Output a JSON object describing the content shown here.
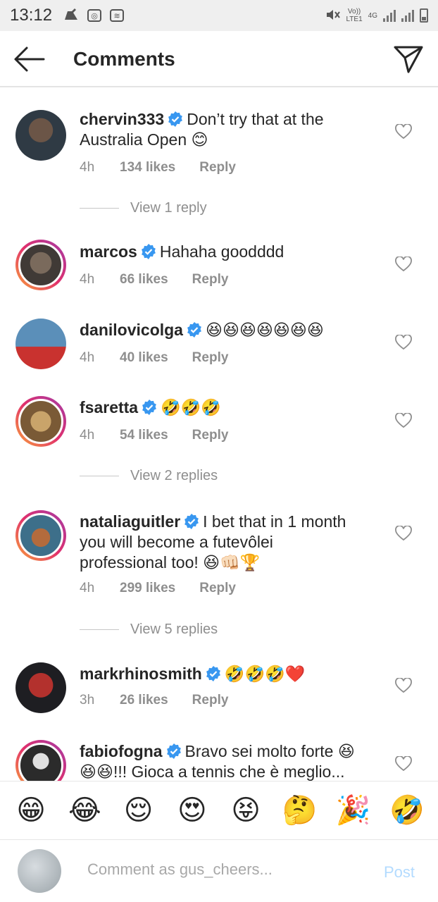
{
  "status": {
    "time": "13:12",
    "net_top": "Vo))",
    "net_bottom": "LTE1",
    "gen": "4G"
  },
  "header": {
    "title": "Comments"
  },
  "comments": [
    {
      "username": "chervin333",
      "text": "Don’t try that at the Australia Open 😊",
      "time": "4h",
      "likes": "134 likes",
      "reply": "Reply",
      "view_replies": "View 1 reply"
    },
    {
      "username": "marcos",
      "text": "Hahaha goodddd",
      "time": "4h",
      "likes": "66 likes",
      "reply": "Reply"
    },
    {
      "username": "danilovicolga",
      "text": "😆😆😆😆😆😆😆",
      "time": "4h",
      "likes": "40 likes",
      "reply": "Reply"
    },
    {
      "username": "fsaretta",
      "text": "🤣🤣🤣",
      "time": "4h",
      "likes": "54 likes",
      "reply": "Reply",
      "view_replies": "View 2 replies"
    },
    {
      "username": "nataliaguitler",
      "text": "I bet that in 1 month you will become a futevôlei professional too! 😆👊🏻🏆",
      "time": "4h",
      "likes": "299 likes",
      "reply": "Reply",
      "view_replies": "View 5 replies"
    },
    {
      "username": "markrhinosmith",
      "text": "🤣🤣🤣❤️",
      "time": "3h",
      "likes": "26 likes",
      "reply": "Reply"
    },
    {
      "username": "fabiofogna",
      "text": "Bravo sei molto forte 😆 😆😆!!! Gioca a tennis che è meglio..."
    }
  ],
  "emoji_bar": [
    "😁",
    "😂",
    "😌",
    "😍",
    "😝",
    "🤔",
    "🎉",
    "🤣"
  ],
  "input": {
    "placeholder": "Comment as gus_cheers...",
    "post_label": "Post"
  },
  "colors": {
    "verified": "#3897f0",
    "link_disabled": "#b3dbff",
    "meta_gray": "#8e8e8e"
  }
}
